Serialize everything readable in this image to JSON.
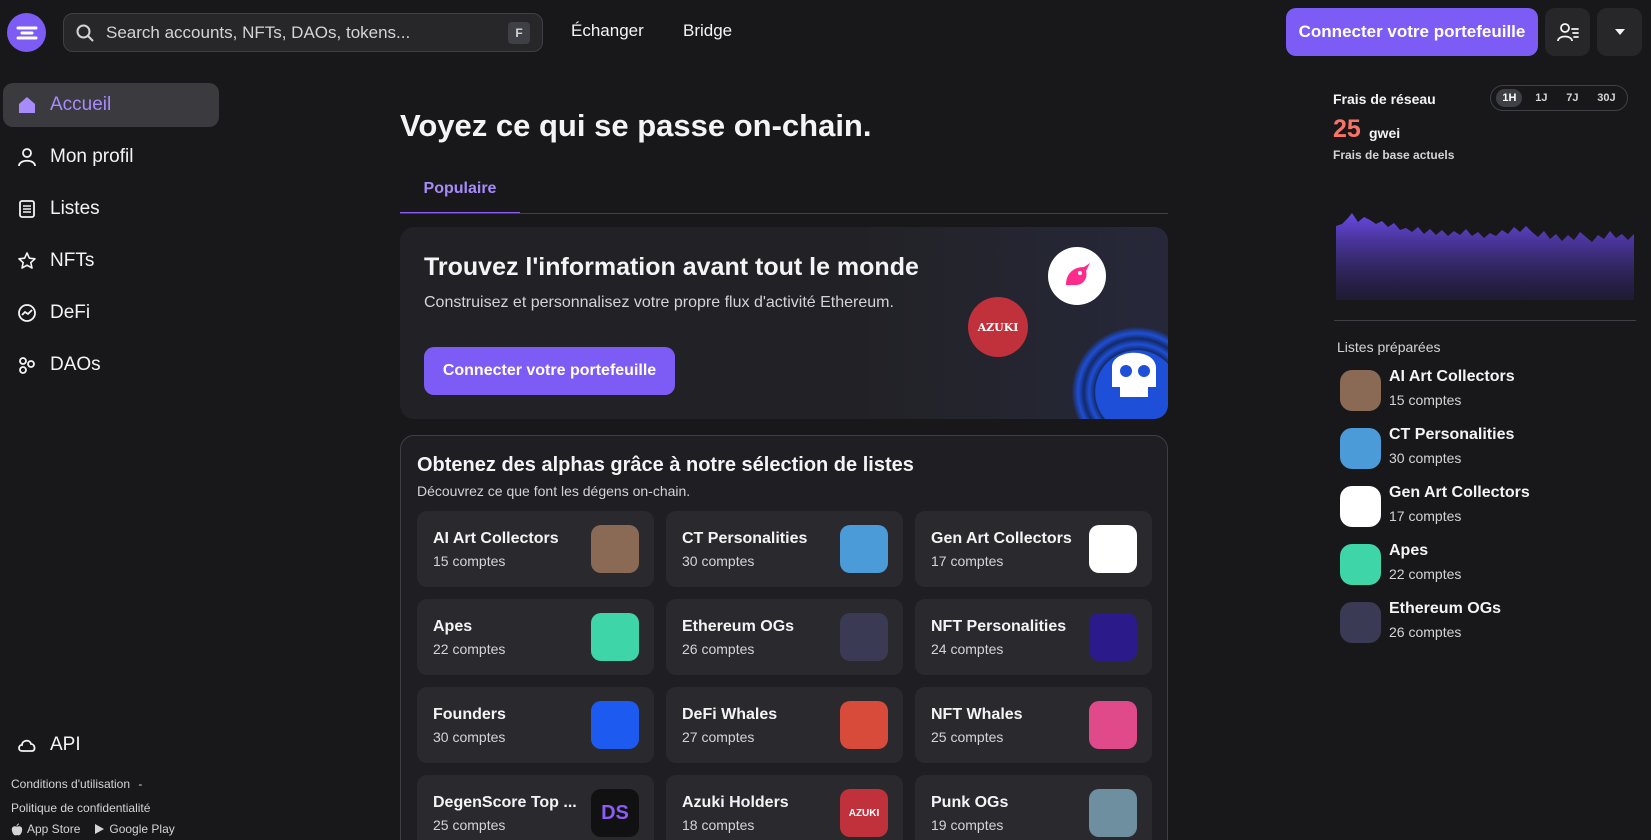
{
  "header": {
    "search_placeholder": "Search accounts, NFTs, DAOs, tokens...",
    "search_shortcut": "F",
    "nav": [
      "Échanger",
      "Bridge"
    ],
    "connect_label": "Connecter votre portefeuille"
  },
  "sidebar": {
    "items": [
      {
        "label": "Accueil",
        "icon": "home-icon",
        "active": true
      },
      {
        "label": "Mon profil",
        "icon": "user-icon"
      },
      {
        "label": "Listes",
        "icon": "list-icon"
      },
      {
        "label": "NFTs",
        "icon": "star-icon"
      },
      {
        "label": "DeFi",
        "icon": "trend-icon"
      },
      {
        "label": "DAOs",
        "icon": "dao-icon"
      }
    ],
    "api_label": "API",
    "terms": "Conditions d'utilisation",
    "separator": "-",
    "privacy": "Politique de confidentialité",
    "app_store": "App Store",
    "google_play": "Google Play"
  },
  "main": {
    "title": "Voyez ce qui se passe on-chain.",
    "tab": "Populaire",
    "hero": {
      "title": "Trouvez l'information avant tout le monde",
      "subtitle": "Construisez et personnalisez votre propre flux d'activité Ethereum.",
      "button": "Connecter votre portefeuille",
      "badge": "AZUKI"
    },
    "lists": {
      "title": "Obtenez des alphas grâce à notre sélection de listes",
      "subtitle": "Découvrez ce que font les dégens on-chain.",
      "tiles": [
        {
          "name": "AI Art Collectors",
          "count": "15 comptes",
          "color": "#8a6a55",
          "glyph": ""
        },
        {
          "name": "CT Personalities",
          "count": "30 comptes",
          "color": "#4a9bd8",
          "glyph": ""
        },
        {
          "name": "Gen Art Collectors",
          "count": "17 comptes",
          "color": "#ffffff",
          "glyph": ""
        },
        {
          "name": "Apes",
          "count": "22 comptes",
          "color": "#3ed6a8",
          "glyph": ""
        },
        {
          "name": "Ethereum OGs",
          "count": "26 comptes",
          "color": "#3a3a55",
          "glyph": ""
        },
        {
          "name": "NFT Personalities",
          "count": "24 comptes",
          "color": "#2b1a8a",
          "glyph": ""
        },
        {
          "name": "Founders",
          "count": "30 comptes",
          "color": "#1d5af0",
          "glyph": ""
        },
        {
          "name": "DeFi Whales",
          "count": "27 comptes",
          "color": "#d84a3a",
          "glyph": ""
        },
        {
          "name": "NFT Whales",
          "count": "25 comptes",
          "color": "#e04a8a",
          "glyph": ""
        },
        {
          "name": "DegenScore Top ...",
          "count": "25 comptes",
          "color": "#111111",
          "glyph": "DS"
        },
        {
          "name": "Azuki Holders",
          "count": "18 comptes",
          "color": "#c0313c",
          "glyph": "AZUKI"
        },
        {
          "name": "Punk OGs",
          "count": "19 comptes",
          "color": "#6e8fa0",
          "glyph": ""
        }
      ]
    }
  },
  "right_panel": {
    "fee_title": "Frais de réseau",
    "ranges": [
      "1H",
      "1J",
      "7J",
      "30J"
    ],
    "active_range": "1H",
    "fee_value": "25",
    "fee_unit": "gwei",
    "fee_caption": "Frais de base actuels",
    "prepared_title": "Listes préparées",
    "prepared": [
      {
        "name": "AI Art Collectors",
        "count": "15 comptes",
        "color": "#8a6a55"
      },
      {
        "name": "CT Personalities",
        "count": "30 comptes",
        "color": "#4a9bd8"
      },
      {
        "name": "Gen Art Collectors",
        "count": "17 comptes",
        "color": "#ffffff"
      },
      {
        "name": "Apes",
        "count": "22 comptes",
        "color": "#3ed6a8"
      },
      {
        "name": "Ethereum OGs",
        "count": "26 comptes",
        "color": "#3a3a55"
      }
    ]
  },
  "colors": {
    "accent": "#7c5cf5",
    "fee": "#f97366"
  }
}
